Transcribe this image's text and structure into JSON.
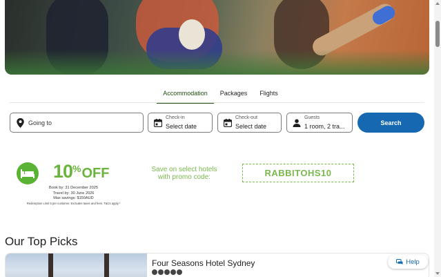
{
  "tabs": [
    {
      "label": "Accommodation",
      "active": true
    },
    {
      "label": "Packages",
      "active": false
    },
    {
      "label": "Flights",
      "active": false
    }
  ],
  "search": {
    "destination_placeholder": "Going to",
    "checkin_label": "Check-in",
    "checkin_value": "Select date",
    "checkout_label": "Check-out",
    "checkout_value": "Select date",
    "guests_label": "Guests",
    "guests_value": "1 room, 2 tra...",
    "button_label": "Search"
  },
  "promo": {
    "discount_number": "10",
    "discount_symbol": "%",
    "discount_word": "OFF",
    "book_by": "Book by: 31 December 2025",
    "travel_by": "Travel by: 30 June 2026",
    "max_savings": "Max savings: $150AUD",
    "fine_print": "Redemption Limit 5 per customer. Excludes taxes and fees. T&Cs apply.*",
    "save_text_line1": "Save on select hotels",
    "save_text_line2": "with promo code:",
    "code": "RABBITOHS10",
    "accent_color": "#6ab43e"
  },
  "top_picks": {
    "title": "Our Top Picks",
    "hotels": [
      {
        "name": "Four Seasons Hotel Sydney",
        "rating": 5
      }
    ]
  },
  "help": {
    "label": "Help"
  },
  "colors": {
    "primary": "#1668b0",
    "tab_active": "#1f4e0f"
  }
}
